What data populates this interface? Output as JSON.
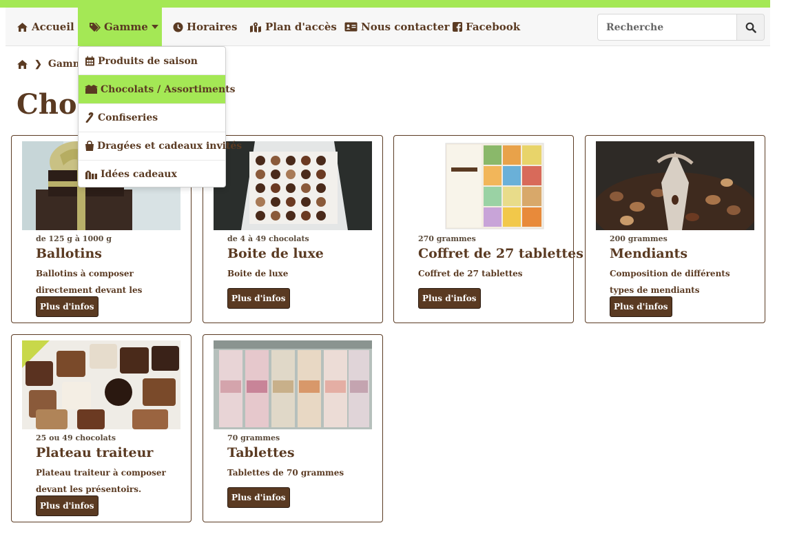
{
  "nav": {
    "home": "Accueil",
    "gamme": "Gamme",
    "horaires": "Horaires",
    "plan": "Plan d'accès",
    "contact": "Nous contacter",
    "facebook": "Facebook"
  },
  "search": {
    "placeholder": "Recherche"
  },
  "breadcrumb": {
    "current": "Gamme"
  },
  "page": {
    "title": "Choco"
  },
  "dropdown": {
    "items": [
      {
        "label": "Produits de saison",
        "icon": "calendar-icon"
      },
      {
        "label": "Chocolats / Assortiments",
        "icon": "box-open-icon"
      },
      {
        "label": "Confiseries",
        "icon": "candy-cane-icon"
      },
      {
        "label": "Dragées et cadeaux invités",
        "icon": "shopping-bag-icon"
      },
      {
        "label": "Idées cadeaux",
        "icon": "gifts-icon"
      }
    ]
  },
  "products": [
    {
      "meta": "de 125 g à 1000 g",
      "title": "Ballotins",
      "desc": "Ballotins à composer directement devant les présentoirs.",
      "button": "Plus d'infos"
    },
    {
      "meta": "de 4 à 49 chocolats",
      "title": "Boite de luxe",
      "desc": "Boite de luxe",
      "button": "Plus d'infos"
    },
    {
      "meta": "270 grammes",
      "title": "Coffret de 27 tablettes",
      "desc": "Coffret de 27 tablettes",
      "button": "Plus d'infos"
    },
    {
      "meta": "200 grammes",
      "title": "Mendiants",
      "desc": "Composition de différents types de mendiants",
      "button": "Plus d'infos"
    },
    {
      "meta": "25 ou 49 chocolats",
      "title": "Plateau traiteur",
      "desc": "Plateau traiteur à composer devant les présentoirs.",
      "button": "Plus d'infos"
    },
    {
      "meta": "70 grammes",
      "title": "Tablettes",
      "desc": "Tablettes de 70 grammes",
      "button": "Plus d'infos"
    }
  ],
  "colors": {
    "accent": "#a4e855",
    "brown": "#5a3a22"
  }
}
